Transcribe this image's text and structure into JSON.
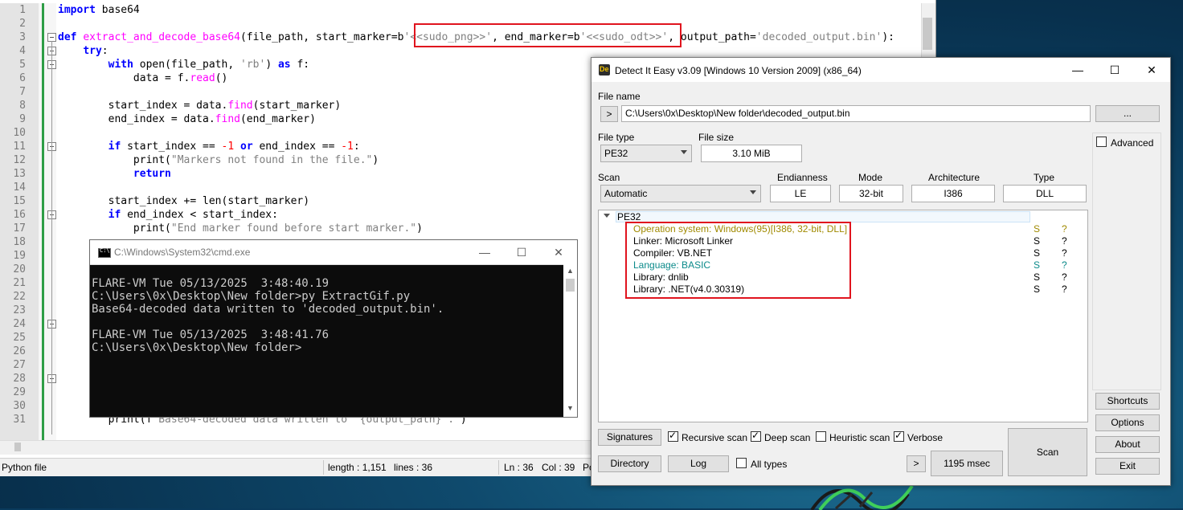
{
  "editor": {
    "line_numbers": [
      "1",
      "2",
      "3",
      "4",
      "5",
      "6",
      "7",
      "8",
      "9",
      "10",
      "11",
      "12",
      "13",
      "14",
      "15",
      "16",
      "17",
      "18",
      "19",
      "20",
      "21",
      "22",
      "23",
      "24",
      "25",
      "26",
      "27",
      "28",
      "29",
      "30",
      "31"
    ],
    "status": {
      "type": "Python file",
      "length": "length : 1,151",
      "lines": "lines : 36",
      "ln": "Ln : 36",
      "col": "Col : 39",
      "pos": "Po"
    }
  },
  "cmd": {
    "title": "C:\\Windows\\System32\\cmd.exe",
    "lines": [
      "FLARE-VM Tue 05/13/2025  3:48:40.19",
      "C:\\Users\\0x\\Desktop\\New folder>py ExtractGif.py",
      "Base64-decoded data written to 'decoded_output.bin'.",
      "",
      "FLARE-VM Tue 05/13/2025  3:48:41.76",
      "C:\\Users\\0x\\Desktop\\New folder>"
    ]
  },
  "die": {
    "title": "Detect It Easy v3.09 [Windows 10 Version 2009] (x86_64)",
    "file_name_label": "File name",
    "file_path": "C:\\Users\\0x\\Desktop\\New folder\\decoded_output.bin",
    "browse_label": "...",
    "arrow_label": ">",
    "file_type_label": "File type",
    "file_type": "PE32",
    "file_size_label": "File size",
    "file_size": "3.10 MiB",
    "scan_label": "Scan",
    "scan_mode": "Automatic",
    "endianness_label": "Endianness",
    "endianness": "LE",
    "mode_label": "Mode",
    "mode": "32-bit",
    "arch_label": "Architecture",
    "arch": "I386",
    "type_label": "Type",
    "type": "DLL",
    "tree_root": "PE32",
    "results": [
      {
        "text": "Operation system: Windows(95)[I386, 32-bit, DLL]",
        "s": "S",
        "q": "?",
        "color": "olive"
      },
      {
        "text": "Linker: Microsoft Linker",
        "s": "S",
        "q": "?",
        "color": "black"
      },
      {
        "text": "Compiler: VB.NET",
        "s": "S",
        "q": "?",
        "color": "black"
      },
      {
        "text": "Language: BASIC",
        "s": "S",
        "q": "?",
        "color": "teal"
      },
      {
        "text": "Library: dnlib",
        "s": "S",
        "q": "?",
        "color": "black"
      },
      {
        "text": "Library: .NET(v4.0.30319)",
        "s": "S",
        "q": "?",
        "color": "black"
      }
    ],
    "advanced_label": "Advanced",
    "shortcuts_label": "Shortcuts",
    "options_label": "Options",
    "about_label": "About",
    "exit_label": "Exit",
    "signatures_label": "Signatures",
    "recursive_label": "Recursive scan",
    "deep_label": "Deep scan",
    "heuristic_label": "Heuristic scan",
    "verbose_label": "Verbose",
    "directory_label": "Directory",
    "log_label": "Log",
    "all_types_label": "All types",
    "next_label": ">",
    "time": "1195 msec",
    "scan_button": "Scan"
  }
}
